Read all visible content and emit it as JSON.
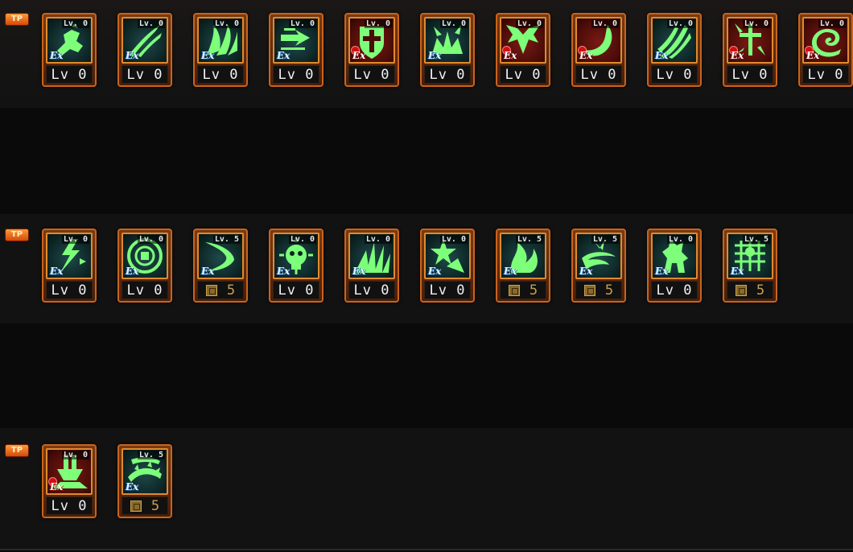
{
  "rows": [
    {
      "badge": "TP",
      "skills": [
        {
          "icon": "fist-punch-icon",
          "type": "ex",
          "badge": "Lv. 0",
          "label": "Lv 0"
        },
        {
          "icon": "claw-slash-icon",
          "type": "ex",
          "badge": "Lv. 0",
          "label": "Lv 0"
        },
        {
          "icon": "flame-wave-icon",
          "type": "ex",
          "badge": "Lv. 0",
          "label": "Lv 0"
        },
        {
          "icon": "dash-arrow-icon",
          "type": "ex",
          "badge": "Lv. 0",
          "label": "Lv 0"
        },
        {
          "icon": "shield-cross-icon",
          "type": "red",
          "badge": "Lv. 0",
          "label": "Lv 0"
        },
        {
          "icon": "crown-burst-icon",
          "type": "ex",
          "badge": "Lv. 0",
          "label": "Lv 0"
        },
        {
          "icon": "winged-demon-icon",
          "type": "red",
          "badge": "Lv. 0",
          "label": "Lv 0"
        },
        {
          "icon": "crescent-moon-icon",
          "type": "red",
          "badge": "Lv. 0",
          "label": "Lv 0"
        },
        {
          "icon": "triple-slash-icon",
          "type": "ex",
          "badge": "Lv. 0",
          "label": "Lv 0"
        },
        {
          "icon": "sword-burst-icon",
          "type": "red",
          "badge": "Lv. 0",
          "label": "Lv 0"
        },
        {
          "icon": "spiral-vortex-icon",
          "type": "red",
          "badge": "Lv. 0",
          "label": "Lv 0"
        }
      ]
    },
    {
      "badge": "TP",
      "skills": [
        {
          "icon": "lightning-strike-icon",
          "type": "ex",
          "badge": "Lv. 0",
          "label": "Lv 0"
        },
        {
          "icon": "energy-ring-icon",
          "type": "ex",
          "badge": "Lv. 0",
          "label": "Lv 0"
        },
        {
          "icon": "arc-slash-icon",
          "type": "ex",
          "badge": "Lv. 5",
          "cost": "5"
        },
        {
          "icon": "skull-aura-icon",
          "type": "ex",
          "badge": "Lv. 0",
          "label": "Lv 0"
        },
        {
          "icon": "radiant-beam-icon",
          "type": "ex",
          "badge": "Lv. 0",
          "label": "Lv 0"
        },
        {
          "icon": "star-impact-icon",
          "type": "ex",
          "badge": "Lv. 0",
          "label": "Lv 0"
        },
        {
          "icon": "rising-flame-icon",
          "type": "ex",
          "badge": "Lv. 5",
          "cost": "5"
        },
        {
          "icon": "whirlwind-icon",
          "type": "ex",
          "badge": "Lv. 5",
          "cost": "5"
        },
        {
          "icon": "beast-form-icon",
          "type": "ex",
          "badge": "Lv. 0",
          "label": "Lv 0"
        },
        {
          "icon": "spirit-grid-icon",
          "type": "ex",
          "badge": "Lv. 5",
          "cost": "5"
        }
      ]
    },
    {
      "badge": "TP",
      "skills": [
        {
          "icon": "ground-slam-icon",
          "type": "red",
          "badge": "Lv. 0",
          "label": "Lv 0"
        },
        {
          "icon": "thorn-whip-icon",
          "type": "ex",
          "badge": "Lv. 5",
          "cost": "5"
        }
      ]
    }
  ],
  "ex_label": "Ex",
  "colors": {
    "frame": "#c8641e",
    "ex_bg": "#0d2424",
    "red_bg": "#4a0c08",
    "glyph": "#7dff7a",
    "cost": "#c8a050"
  }
}
